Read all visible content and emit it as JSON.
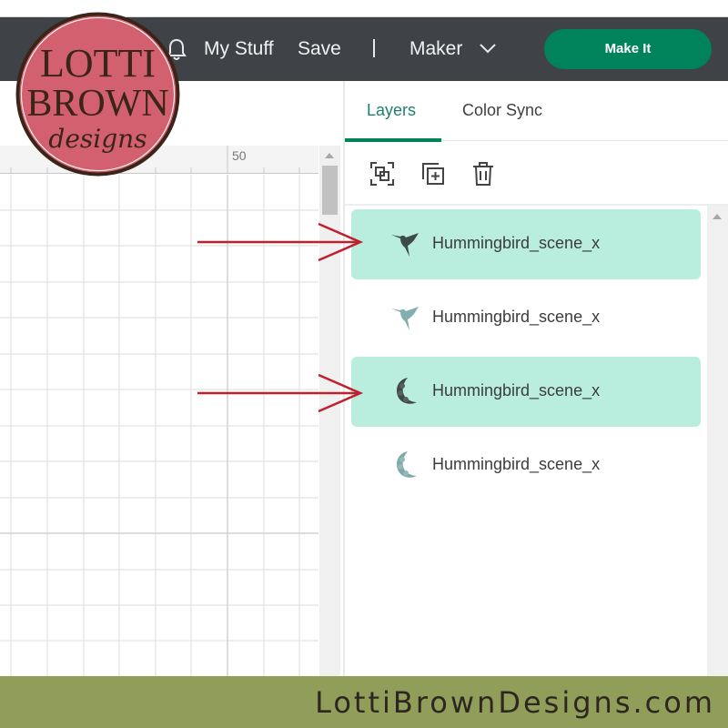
{
  "topbar": {
    "notifications_icon": "bell-icon",
    "my_stuff": "My Stuff",
    "save": "Save",
    "separator": "|",
    "machine": "Maker",
    "machine_icon": "chevron-down-icon",
    "make_it": "Make It"
  },
  "canvas": {
    "ruler_label": "50"
  },
  "panel": {
    "tabs": [
      {
        "label": "Layers",
        "active": true
      },
      {
        "label": "Color Sync",
        "active": false
      }
    ],
    "tools": [
      "group-icon",
      "duplicate-icon",
      "delete-icon"
    ],
    "layers": [
      {
        "name": "Hummingbird_scene_x",
        "selected": true,
        "thumb": "hummingbird-dark",
        "color": "#3d4a45"
      },
      {
        "name": "Hummingbird_scene_x",
        "selected": false,
        "thumb": "hummingbird-teal",
        "color": "#84afb0"
      },
      {
        "name": "Hummingbird_scene_x",
        "selected": true,
        "thumb": "floral-crescent-dark",
        "color": "#3f4844"
      },
      {
        "name": "Hummingbird_scene_x",
        "selected": false,
        "thumb": "floral-crescent-teal",
        "color": "#7fa9a8"
      }
    ]
  },
  "annotations": {
    "arrow_color": "#c0202e"
  },
  "branding": {
    "logo_line1": "LOTTI",
    "logo_line2": "BROWN",
    "logo_line3": "designs",
    "footer": "LottiBrownDesigns.com"
  },
  "colors": {
    "accent": "#00825a",
    "selected_row": "#b9eedf",
    "topbar": "#3f4348",
    "footer": "#919e5a",
    "logo_fill": "#d3606f",
    "logo_ink": "#3b2418"
  }
}
